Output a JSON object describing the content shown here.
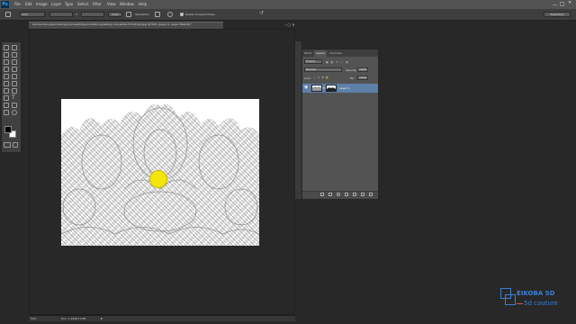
{
  "app": {
    "logo": "Ps"
  },
  "menu": [
    "File",
    "Edit",
    "Image",
    "Layer",
    "Type",
    "Select",
    "Filter",
    "View",
    "Window",
    "Help"
  ],
  "options_bar": {
    "mode_value": "Auto",
    "refine_button": "Clear",
    "straighten_label": "Straighten",
    "delete_cropped_label": "Delete Cropped Pixels",
    "workspace": "Essentials"
  },
  "document": {
    "title": "lace-border-green-background-wedding-invitation-greeting-card-white-57121414.jpg @ 50% (Layer 0, Layer Mask/8) *",
    "zoom": "50%",
    "doc_info": "Doc: 1.49M/3.10M"
  },
  "layers_panel": {
    "tabs": [
      "Paths",
      "Layers",
      "Channels"
    ],
    "active_tab": "Layers",
    "kind_filter": "Kind",
    "blend_mode": "Normal",
    "opacity_label": "Opacity:",
    "opacity_value": "100%",
    "lock_label": "Lock:",
    "fill_label": "Fill:",
    "fill_value": "100%",
    "layer_name": "Layer 0"
  },
  "watermark": {
    "brand": "EIKOBA SD",
    "sub": "5d couture"
  },
  "colors": {
    "selection": "#5d7fa8",
    "cursor_highlight": "#f4e60a",
    "watermark": "#3b7fd6"
  }
}
